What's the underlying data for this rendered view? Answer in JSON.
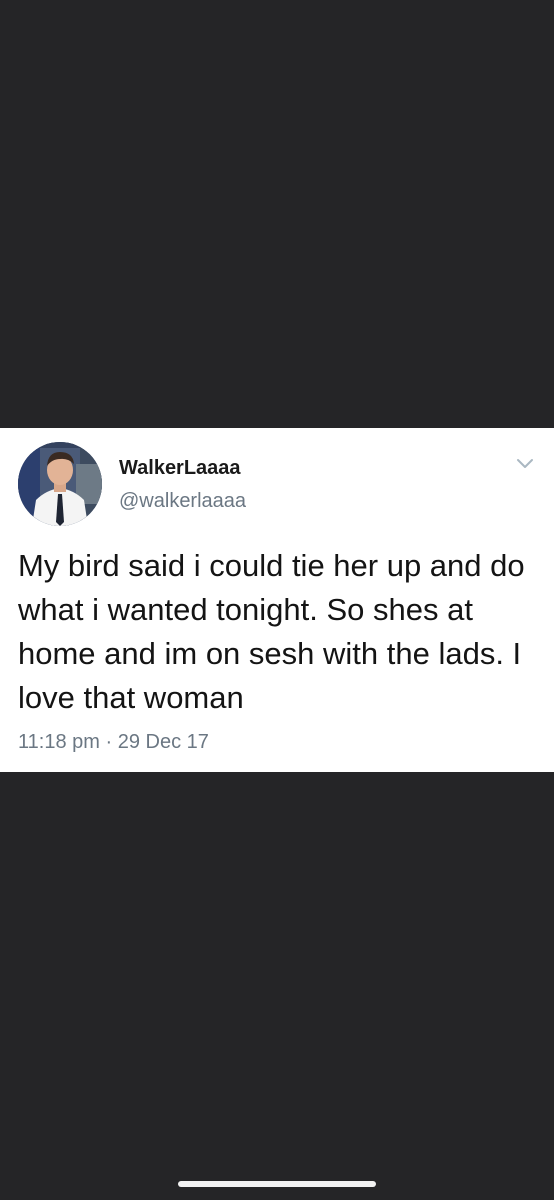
{
  "tweet": {
    "display_name": "WalkerLaaaa",
    "handle": "@walkerlaaaa",
    "text": "My bird said i could tie her up and do what i wanted tonight. So shes at home and im on sesh with the lads. I love that woman",
    "time": "11:18 pm",
    "separator": "·",
    "date": "29 Dec 17",
    "avatar_icon": "profile-photo",
    "menu_icon": "chevron-down-icon"
  },
  "colors": {
    "background": "#252527",
    "card": "#ffffff",
    "text": "#141414",
    "secondary_text": "#6b7783",
    "chevron": "#aab8c2"
  }
}
